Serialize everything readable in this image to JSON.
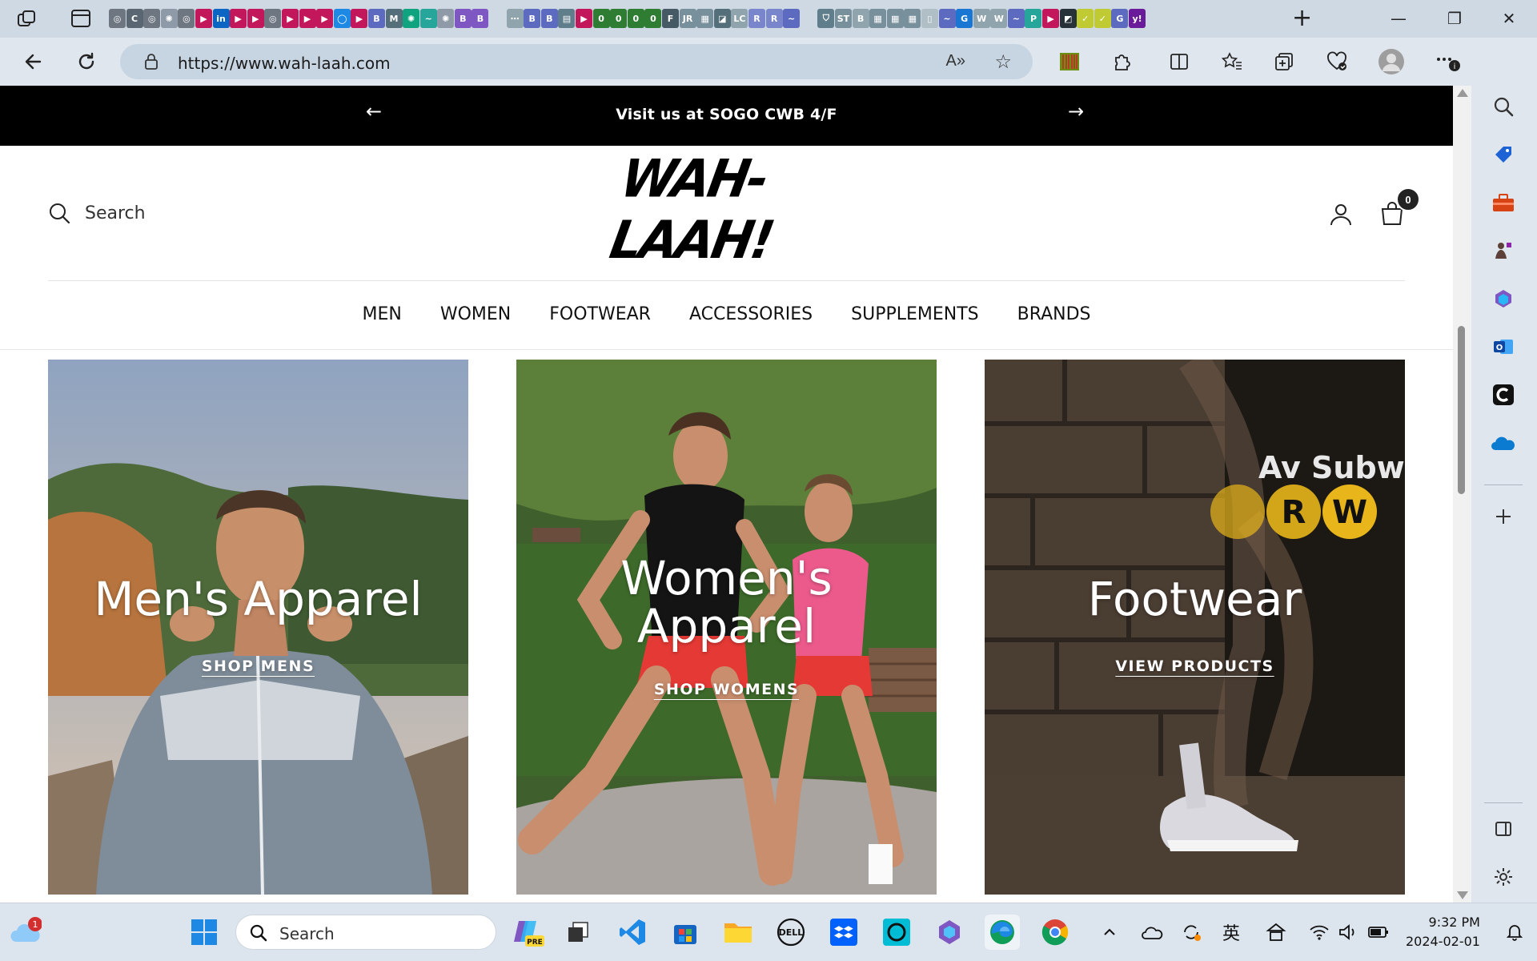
{
  "browser": {
    "url": "https://www.wah-laah.com",
    "new_tab_symbol": "+",
    "window_controls": [
      "minimize",
      "restore",
      "close"
    ]
  },
  "announcement": {
    "text": "Visit us at SOGO CWB 4/F",
    "prev_arrow": "←",
    "next_arrow": "→"
  },
  "header": {
    "search_label": "Search",
    "logo_text": "WAH-LAAH!",
    "cart_count": "0"
  },
  "nav": {
    "items": [
      "MEN",
      "WOMEN",
      "FOOTWEAR",
      "ACCESSORIES",
      "SUPPLEMENTS",
      "BRANDS"
    ]
  },
  "tiles": [
    {
      "title": "Men's Apparel",
      "cta": "SHOP MENS"
    },
    {
      "title_line1": "Women's",
      "title_line2": "Apparel",
      "cta": "SHOP WOMENS"
    },
    {
      "title": "Footwear",
      "cta": "VIEW PRODUCTS",
      "sign_text": "Av Subwa",
      "sign_letters": [
        "R",
        "W"
      ]
    }
  ],
  "taskbar": {
    "search_label": "Search",
    "weather_badge": "1",
    "copilot_badge": "PRE",
    "lang_indicator": "英",
    "time": "9:32 PM",
    "date": "2024-02-01"
  },
  "colors": {
    "announcement_bg": "#000000",
    "page_bg": "#ffffff",
    "chrome_bg": "#dfe6ee"
  }
}
